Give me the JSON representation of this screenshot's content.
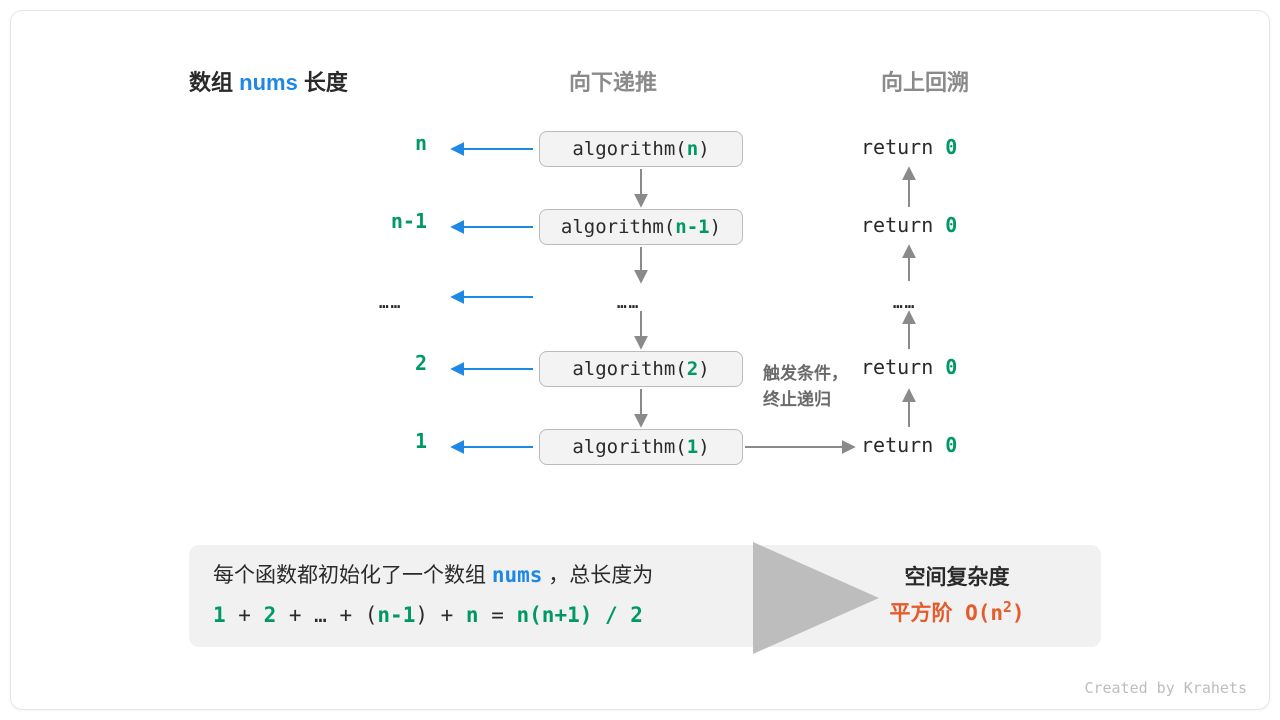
{
  "headers": {
    "left_prefix": "数组 ",
    "left_var": "nums",
    "left_suffix": " 长度",
    "middle": "向下递推",
    "right": "向上回溯"
  },
  "rows": [
    {
      "param": "n",
      "call_fn": "algorithm(",
      "call_arg": "n",
      "call_close": ")",
      "ret_kw": "return ",
      "ret_val": "0"
    },
    {
      "param": "n-1",
      "call_fn": "algorithm(",
      "call_arg": "n-1",
      "call_close": ")",
      "ret_kw": "return ",
      "ret_val": "0"
    },
    {
      "param": "2",
      "call_fn": "algorithm(",
      "call_arg": "2",
      "call_close": ")",
      "ret_kw": "return ",
      "ret_val": "0"
    },
    {
      "param": "1",
      "call_fn": "algorithm(",
      "call_arg": "1",
      "call_close": ")",
      "ret_kw": "return ",
      "ret_val": "0"
    }
  ],
  "ellipsis": "……",
  "note_line1": "触发条件，",
  "note_line2": "终止递归",
  "summary": {
    "line1_prefix": "每个函数都初始化了一个数组 ",
    "line1_var": "nums",
    "line1_suffix": " ，总长度为",
    "eq_tokens": {
      "a": "1",
      "plus1": " + ",
      "b": "2",
      "plus2": " + … + (",
      "c": "n-1",
      "close": ") + ",
      "d": "n",
      "eq": " = ",
      "rhs": "n(n+1) / 2"
    },
    "right_label": "空间复杂度",
    "right_order_prefix": "平方阶 O(n",
    "right_order_sup": "2",
    "right_order_suffix": ")"
  },
  "credit": "Created by Krahets",
  "chart_data": {
    "type": "diagram",
    "title": "Recursion space complexity (quadratic)",
    "recursion_down": [
      "algorithm(n)",
      "algorithm(n-1)",
      "…",
      "algorithm(2)",
      "algorithm(1)"
    ],
    "recursion_up": [
      "return 0",
      "return 0",
      "…",
      "return 0",
      "return 0"
    ],
    "array_lengths": [
      "n",
      "n-1",
      "…",
      "2",
      "1"
    ],
    "total_length_formula": "1 + 2 + … + (n-1) + n = n(n+1)/2",
    "space_complexity": "O(n^2)"
  }
}
